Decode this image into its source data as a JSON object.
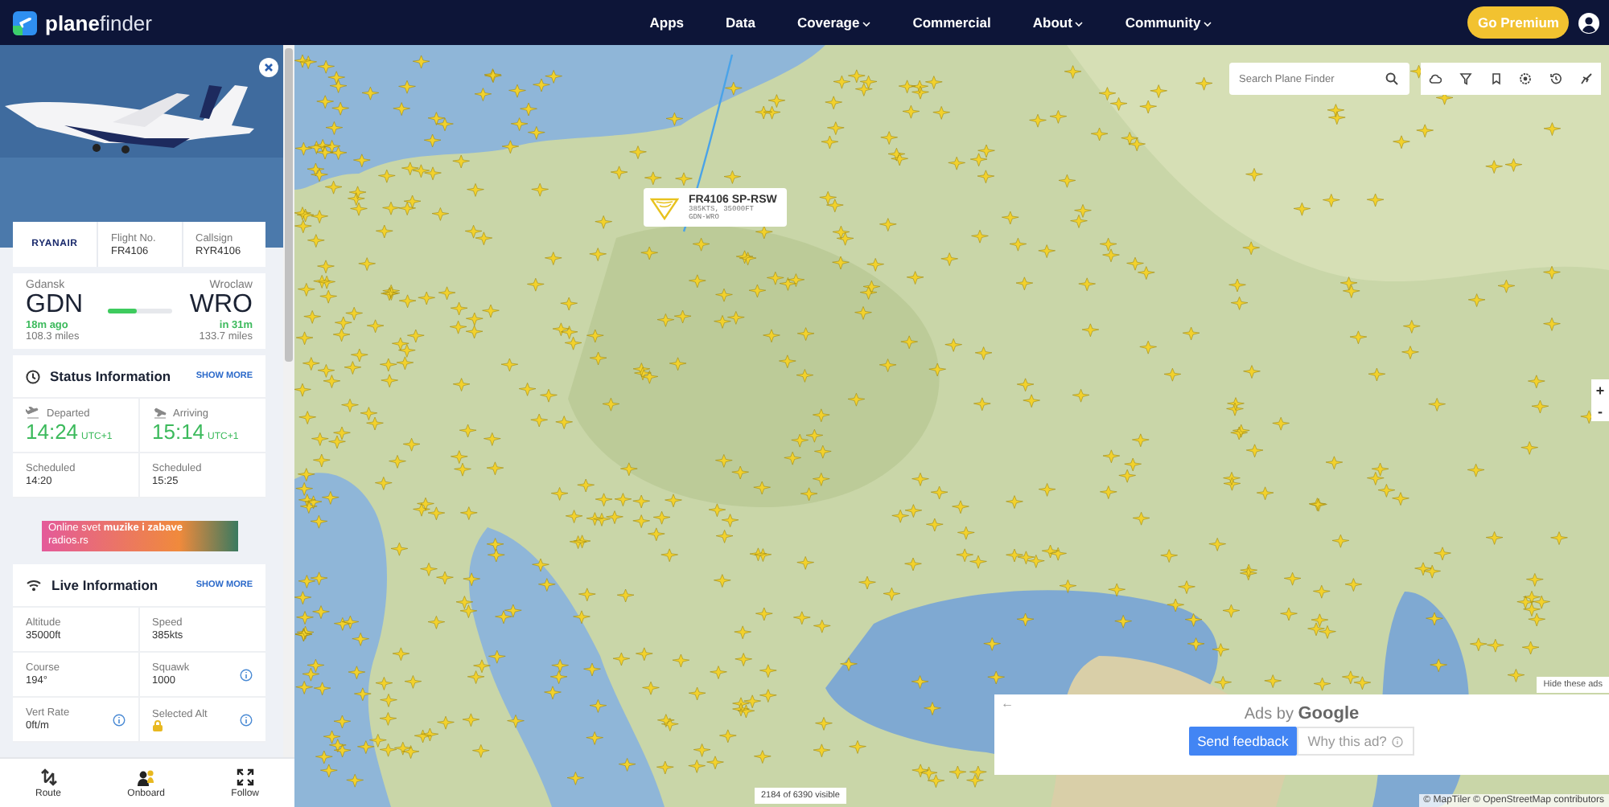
{
  "header": {
    "logo": "**plane**finder",
    "nav": [
      {
        "label": "Apps",
        "dropdown": false
      },
      {
        "label": "Data",
        "dropdown": false
      },
      {
        "label": "Coverage",
        "dropdown": true
      },
      {
        "label": "Commercial",
        "dropdown": false
      },
      {
        "label": "About",
        "dropdown": true
      },
      {
        "label": "Community",
        "dropdown": true
      }
    ],
    "premium": "Go Premium"
  },
  "flight": {
    "airline": "RYANAIR",
    "fields": [
      {
        "label": "Flight No.",
        "value": "FR4106"
      },
      {
        "label": "Callsign",
        "value": "RYR4106"
      }
    ]
  },
  "route": {
    "from_city": "Gdansk",
    "from_code": "GDN",
    "from_time": "18m ago",
    "from_dist": "108.3 miles",
    "to_city": "Wroclaw",
    "to_code": "WRO",
    "to_time": "in 31m",
    "to_dist": "133.7 miles",
    "level": 0.45
  },
  "status": {
    "title": "Status Information",
    "more": "SHOW MORE",
    "times": [
      {
        "label": "Departed",
        "time": "14:24",
        "zone": "UTC+1",
        "kind": "takeoff"
      },
      {
        "label": "Arriving",
        "time": "15:14",
        "zone": "UTC+1",
        "kind": "landing"
      }
    ],
    "scheduled": [
      {
        "label": "Scheduled",
        "value": "14:20"
      },
      {
        "label": "Scheduled",
        "value": "15:25"
      }
    ]
  },
  "ad_banner": {
    "text": "Online svet **muzike i zabave**",
    "site": "radios.rs"
  },
  "live": {
    "title": "Live Information",
    "more": "SHOW MORE",
    "fields": [
      {
        "label": "Altitude",
        "value": "35000ft",
        "info": false,
        "locked": false
      },
      {
        "label": "Speed",
        "value": "385kts",
        "info": false,
        "locked": false
      },
      {
        "label": "Course",
        "value": "194°",
        "info": false,
        "locked": false
      },
      {
        "label": "Squawk",
        "value": "1000",
        "info": true,
        "locked": false
      },
      {
        "label": "Vert Rate",
        "value": "0ft/m",
        "info": true,
        "locked": false
      },
      {
        "label": "Selected Alt",
        "info": true,
        "locked": true
      }
    ]
  },
  "bottom_nav": [
    {
      "label": "Route",
      "kind": "route"
    },
    {
      "label": "Onboard",
      "kind": "onboard"
    },
    {
      "label": "Follow",
      "kind": "follow"
    }
  ],
  "map": {
    "search_placeholder": "Search Plane Finder",
    "popup": {
      "title": "FR4106 SP-RSW",
      "detail": "385KTS, 35000FT",
      "route": "GDN-WRO"
    },
    "zoom": [
      "+",
      "-"
    ],
    "visible_count": "2184 of 6390 visible",
    "attribution": "© MapTiler © OpenStreetMap contributors",
    "ads": {
      "hide": "Hide these ads",
      "back": "←",
      "ads_by": "Ads by **Google**",
      "feedback": "Send feedback",
      "why": "Why this ad?"
    }
  }
}
